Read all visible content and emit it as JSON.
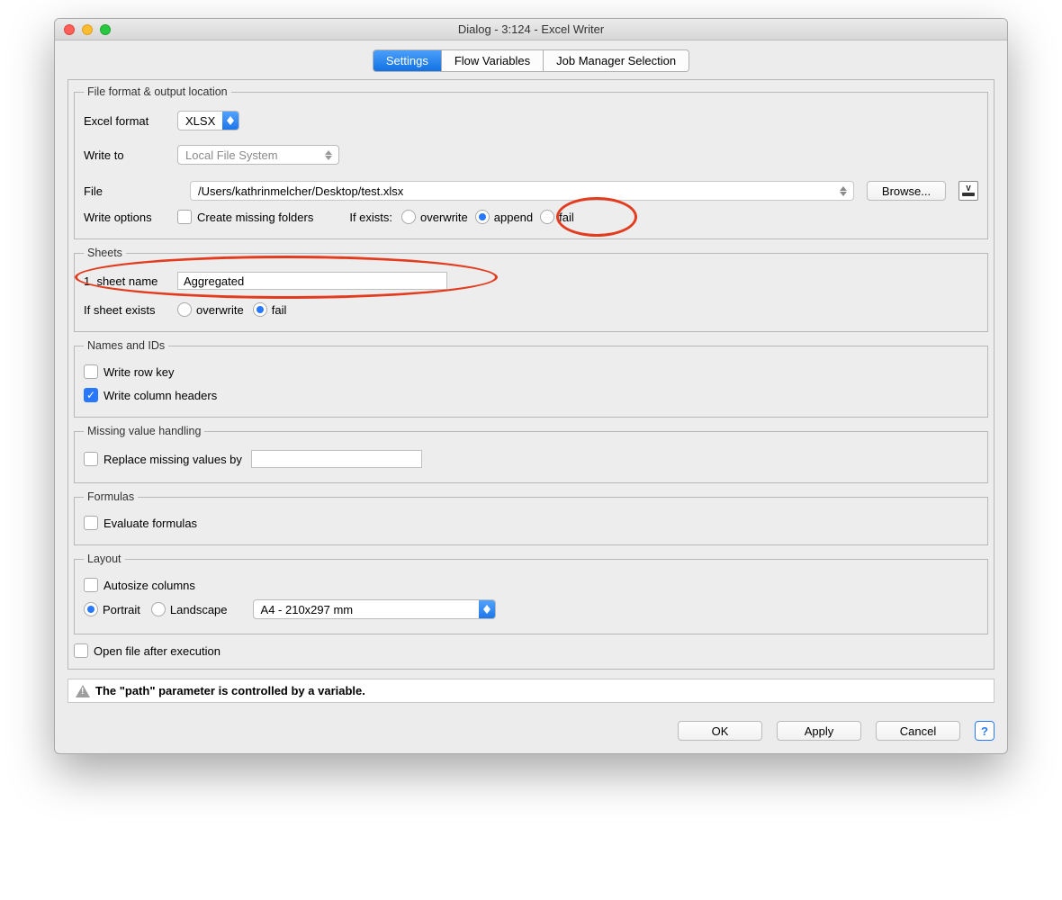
{
  "title": "Dialog - 3:124 - Excel Writer",
  "tabs": {
    "settings": "Settings",
    "flow": "Flow Variables",
    "job": "Job Manager Selection"
  },
  "groups": {
    "file": "File format & output location",
    "sheets": "Sheets",
    "names": "Names and IDs",
    "missing": "Missing value handling",
    "formulas": "Formulas",
    "layout": "Layout"
  },
  "labels": {
    "excel_format": "Excel format",
    "write_to": "Write to",
    "file": "File",
    "write_options": "Write options",
    "create_missing": "Create missing folders",
    "if_exists": "If exists:",
    "browse": "Browse...",
    "sheet_name": "1. sheet name",
    "if_sheet_exists": "If sheet exists",
    "write_row_key": "Write row key",
    "write_col_headers": "Write column headers",
    "replace_missing": "Replace missing values by",
    "evaluate_formulas": "Evaluate formulas",
    "autosize": "Autosize columns",
    "open_after": "Open file after execution"
  },
  "values": {
    "excel_format": "XLSX",
    "write_to": "Local File System",
    "file_path": "/Users/kathrinmelcher/Desktop/test.xlsx",
    "sheet_name": "Aggregated",
    "paper": "A4 - 210x297 mm"
  },
  "radios": {
    "overwrite": "overwrite",
    "append": "append",
    "fail": "fail",
    "sheet_overwrite": "overwrite",
    "sheet_fail": "fail",
    "portrait": "Portrait",
    "landscape": "Landscape"
  },
  "warning": "The \"path\" parameter is controlled by a variable.",
  "buttons": {
    "ok": "OK",
    "apply": "Apply",
    "cancel": "Cancel"
  }
}
